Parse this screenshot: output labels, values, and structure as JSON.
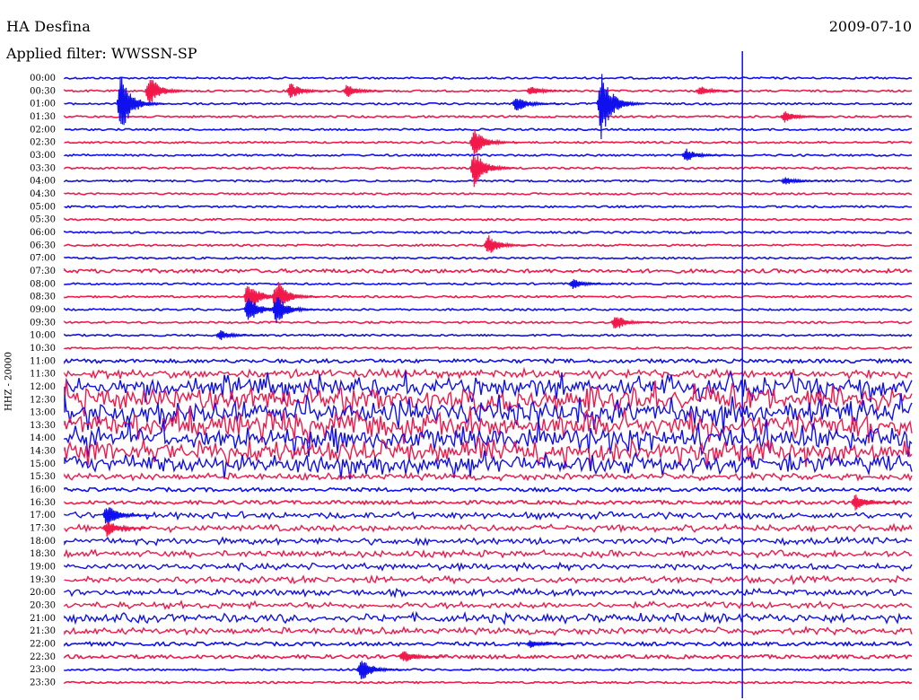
{
  "header": {
    "station": "HA Desfina",
    "date": "2009-07-10",
    "filter": "Applied filter: WWSSN-SP",
    "channel": "HHZ - 20000"
  },
  "colors": {
    "trace_a": "#1010ee",
    "trace_b": "#f0194a",
    "label": "#000000"
  },
  "chart_data": {
    "type": "line",
    "title": "HA Desfina",
    "subtitle": "Applied filter: WWSSN-SP",
    "ylabel": "HHZ - 20000",
    "row_labels": [
      "00:00",
      "00:30",
      "01:00",
      "01:30",
      "02:00",
      "02:30",
      "03:00",
      "03:30",
      "04:00",
      "04:30",
      "05:00",
      "05:30",
      "06:00",
      "06:30",
      "07:00",
      "07:30",
      "08:00",
      "08:30",
      "09:00",
      "09:30",
      "10:00",
      "10:30",
      "11:00",
      "11:30",
      "12:00",
      "12:30",
      "13:00",
      "13:30",
      "14:00",
      "14:30",
      "15:00",
      "15:30",
      "16:00",
      "16:30",
      "17:00",
      "17:30",
      "18:00",
      "18:30",
      "19:00",
      "19:30",
      "20:00",
      "20:30",
      "21:00",
      "21:30",
      "22:00",
      "22:30",
      "23:00",
      "23:30"
    ],
    "row_minutes": 30,
    "row_colors": [
      "trace_a",
      "trace_b"
    ],
    "base_noise": [
      1,
      1,
      1,
      1,
      1,
      1,
      1,
      1,
      1,
      1,
      1,
      1,
      1,
      1,
      1,
      2,
      1,
      1,
      1,
      1,
      1,
      1,
      2,
      4,
      8,
      10,
      10,
      10,
      10,
      9,
      8,
      3,
      2,
      2,
      3,
      3,
      3,
      3,
      3,
      3,
      3,
      3,
      4,
      3,
      2,
      2,
      1,
      1
    ],
    "events": [
      {
        "row": 1,
        "minute": 3.0,
        "amp": 18
      },
      {
        "row": 1,
        "minute": 8.0,
        "amp": 10
      },
      {
        "row": 1,
        "minute": 10.0,
        "amp": 8
      },
      {
        "row": 2,
        "minute": 2.0,
        "amp": 35
      },
      {
        "row": 2,
        "minute": 16.0,
        "amp": 10
      },
      {
        "row": 2,
        "minute": 19.0,
        "amp": 40
      },
      {
        "row": 1,
        "minute": 16.5,
        "amp": 6
      },
      {
        "row": 1,
        "minute": 22.5,
        "amp": 6
      },
      {
        "row": 3,
        "minute": 25.5,
        "amp": 7
      },
      {
        "row": 5,
        "minute": 14.5,
        "amp": 18
      },
      {
        "row": 7,
        "minute": 14.5,
        "amp": 22
      },
      {
        "row": 6,
        "minute": 22.0,
        "amp": 8
      },
      {
        "row": 8,
        "minute": 25.5,
        "amp": 5
      },
      {
        "row": 13,
        "minute": 15.0,
        "amp": 12
      },
      {
        "row": 17,
        "minute": 6.5,
        "amp": 20
      },
      {
        "row": 17,
        "minute": 7.5,
        "amp": 22
      },
      {
        "row": 18,
        "minute": 6.5,
        "amp": 16
      },
      {
        "row": 18,
        "minute": 7.5,
        "amp": 18
      },
      {
        "row": 16,
        "minute": 18.0,
        "amp": 6
      },
      {
        "row": 19,
        "minute": 19.5,
        "amp": 10
      },
      {
        "row": 20,
        "minute": 5.5,
        "amp": 6
      },
      {
        "row": 34,
        "minute": 1.5,
        "amp": 14
      },
      {
        "row": 35,
        "minute": 1.5,
        "amp": 10
      },
      {
        "row": 33,
        "minute": 28.0,
        "amp": 10
      },
      {
        "row": 46,
        "minute": 10.5,
        "amp": 14
      },
      {
        "row": 45,
        "minute": 12.0,
        "amp": 8
      },
      {
        "row": 44,
        "minute": 16.5,
        "amp": 5
      }
    ],
    "marker_minute": 24.0,
    "xlim": [
      0,
      30
    ]
  }
}
